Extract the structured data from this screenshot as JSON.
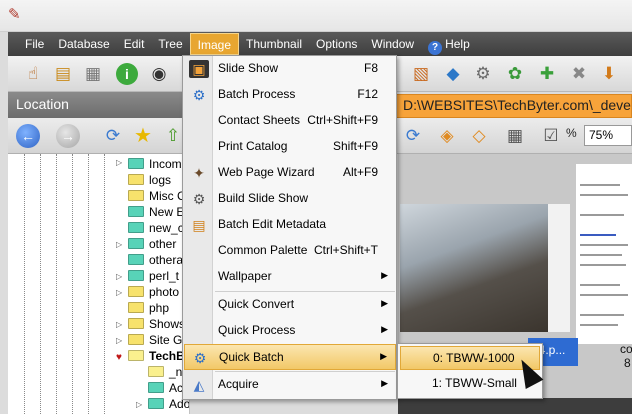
{
  "menubar": {
    "items": [
      "File",
      "Database",
      "Edit",
      "Tree",
      "Image",
      "Thumbnail",
      "Options",
      "Window",
      "Help"
    ]
  },
  "location": {
    "title": "Location"
  },
  "path": {
    "text": "D:\\WEBSITES\\TechByter.com\\_deve"
  },
  "zoom": {
    "label": "%",
    "value": "75%"
  },
  "tree": {
    "items": [
      "Incom",
      "logs",
      "Misc C",
      "New E",
      "new_c",
      "other",
      "othera",
      "perl_t",
      "photo",
      "php",
      "Shows",
      "Site G",
      "TechB",
      "_n",
      "Ac",
      "AdobeCS5"
    ]
  },
  "image_menu": {
    "items": [
      {
        "label": "Slide Show",
        "shortcut": "F8",
        "icon": "slideshow-icon"
      },
      {
        "label": "Batch Process",
        "shortcut": "F12",
        "icon": "batch-process-icon"
      },
      {
        "label": "Contact Sheets",
        "shortcut": "Ctrl+Shift+F9",
        "icon": ""
      },
      {
        "label": "Print Catalog",
        "shortcut": "Shift+F9",
        "icon": ""
      },
      {
        "label": "Web Page Wizard",
        "shortcut": "Alt+F9",
        "icon": "wand-icon"
      },
      {
        "label": "Build Slide Show",
        "shortcut": "",
        "icon": "build-slideshow-icon"
      },
      {
        "label": "Batch Edit Metadata",
        "shortcut": "",
        "icon": "metadata-icon"
      },
      {
        "label": "Common Palette",
        "shortcut": "Ctrl+Shift+T",
        "icon": ""
      },
      {
        "label": "Wallpaper",
        "shortcut": "",
        "icon": ""
      },
      {
        "label": "Quick Convert",
        "shortcut": "",
        "icon": ""
      },
      {
        "label": "Quick Process",
        "shortcut": "",
        "icon": ""
      },
      {
        "label": "Quick Batch",
        "shortcut": "",
        "icon": "quick-batch-icon"
      },
      {
        "label": "Acquire",
        "shortcut": "",
        "icon": "scanner-icon"
      }
    ]
  },
  "quick_batch_submenu": {
    "items": [
      "0: TBWW-1000",
      "1: TBWW-Small"
    ]
  },
  "preview": {
    "selected_label": "04.p...",
    "side_text_1": "co",
    "side_text_2": "8"
  }
}
